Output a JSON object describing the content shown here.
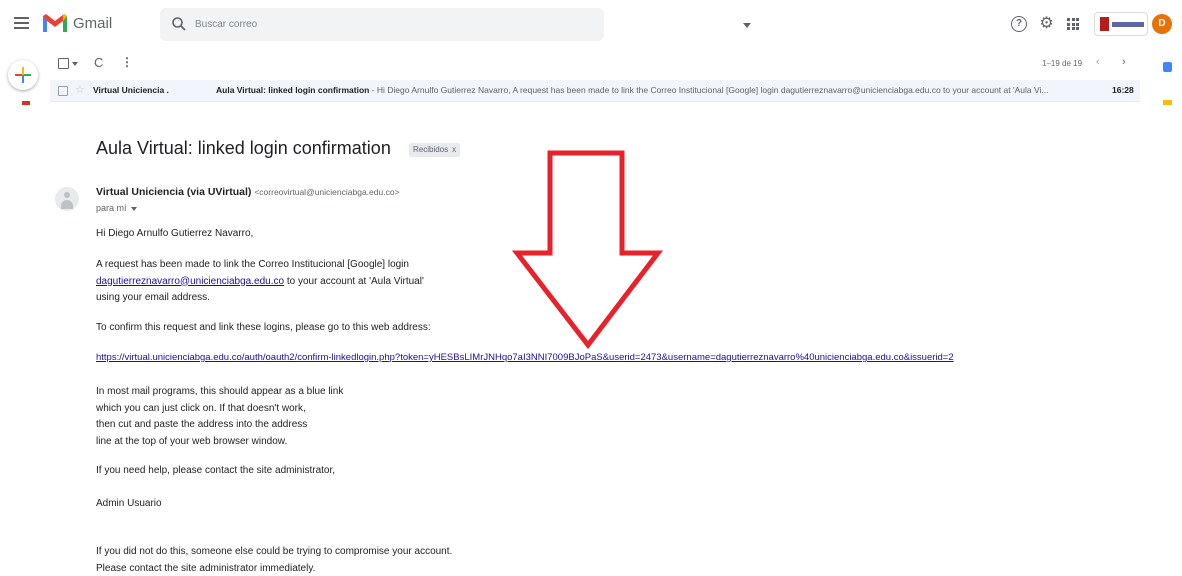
{
  "app": {
    "name": "Gmail",
    "logo_icon": "gmail-m-logo"
  },
  "search": {
    "placeholder": "Buscar correo"
  },
  "header_icons": {
    "help": "?",
    "settings": "⚙",
    "avatar_letter": "D"
  },
  "toolbar": {
    "count_text": "1–19 de 19",
    "prev": "‹",
    "next": "›",
    "refresh": "C",
    "more": "⋮"
  },
  "message_row": {
    "sender": "Virtual Uniciencia .",
    "subject": "Aula Virtual: linked login confirmation",
    "snippet": " - Hi Diego Arnulfo Gutierrez Navarro, A request has been made to link the Correo Institucional [Google] login dagutierreznavarro@unicienciabga.edu.co to your account at 'Aula Vi...",
    "time": "16:28"
  },
  "email": {
    "subject": "Aula Virtual: linked login confirmation",
    "label": "Recibidos",
    "label_close": "x",
    "sender_name": "Virtual Uniciencia (via UVirtual)",
    "sender_email": "<correovirtual@unicienciabga.edu.co>",
    "recipient": "para mí",
    "greeting": "Hi Diego Arnulfo Gutierrez Navarro,",
    "para1_line1": "A request has been made to link the Correo Institucional [Google] login",
    "para1_email": "dagutierreznavarro@unicienciabga.edu.co",
    "para1_line2_rest": " to your account at 'Aula Virtual'",
    "para1_line3": "using your email address.",
    "para2": "To confirm this request and link these logins, please go to this web address:",
    "confirm_link": "https://virtual.unicienciabga.edu.co/auth/oauth2/confirm-linkedlogin.php?token=yHESBsLIMrJNHqo7aI3NNI7009BJoPaS&userid=2473&username=dagutierreznavarro%40unicienciabga.edu.co&issuerid=2",
    "para3_line1": "In most mail programs, this should appear as a blue link",
    "para3_line2": "which you can just click on. If that doesn't work,",
    "para3_line3": "then cut and paste the address into the address",
    "para3_line4": "line at the top of your web browser window.",
    "para4": "If you need help, please contact the site administrator,",
    "signature": "Admin Usuario",
    "para5_line1": "If you did not do this, someone else could be trying to compromise your account.",
    "para5_line2": "Please contact the site administrator immediately."
  },
  "colors": {
    "annotation_arrow": "#e8222a",
    "link": "#1a0dab",
    "avatar_bg": "#e8710a"
  }
}
